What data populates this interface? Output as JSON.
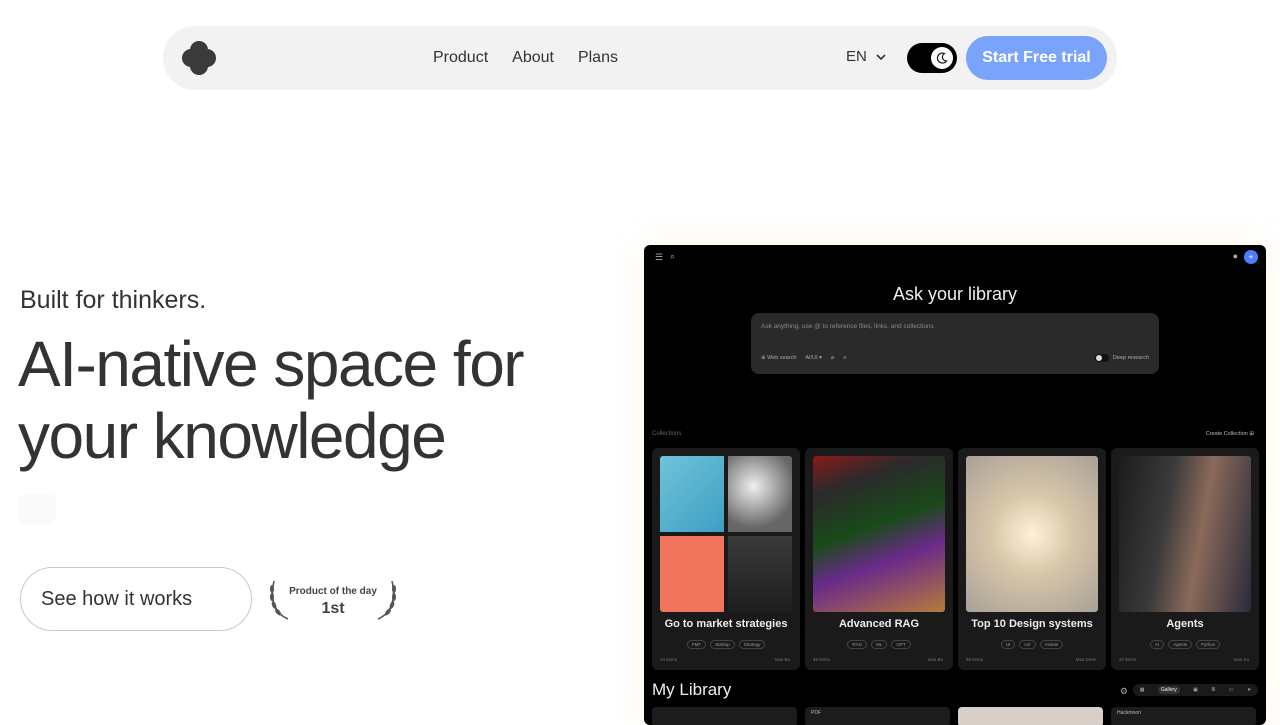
{
  "nav": {
    "links": [
      "Product",
      "About",
      "Plans"
    ],
    "language": "EN",
    "theme_mode": "dark",
    "cta_label": "Start Free trial"
  },
  "hero": {
    "kicker": "Built for thinkers.",
    "headline": "AI-native space for your knowledge",
    "secondary_button": "See how it works",
    "award_line1": "Product of the day",
    "award_line2": "1st"
  },
  "app": {
    "ask_title": "Ask your library",
    "ask_placeholder": "Ask anything, use @ to reference files, links, and collections",
    "tools": {
      "web_search": "Web search",
      "model": "AI/UI",
      "deep_research": "Deep research"
    },
    "collections_label": "Collections",
    "create_collection": "Create Collection",
    "cards": [
      {
        "title": "Go to market strategies",
        "tags": [
          "PMF",
          "Startup",
          "Strategy"
        ],
        "count": "14 items",
        "owner": "Ivan Bo"
      },
      {
        "title": "Advanced RAG",
        "tags": [
          "RAG",
          "ML",
          "GPT"
        ],
        "count": "45 items",
        "owner": "Ivan Bo"
      },
      {
        "title": "Top 10 Design systems",
        "tags": [
          "UI",
          "UX",
          "Assets"
        ],
        "count": "96 items",
        "owner": "Max Drive"
      },
      {
        "title": "Agents",
        "tags": [
          "AI",
          "Agents",
          "Python"
        ],
        "count": "27 items",
        "owner": "Ivan Ko"
      }
    ],
    "my_library": "My Library",
    "view_mode": "Gallery",
    "library_items": [
      "",
      "PDF",
      "",
      "Hackmoon"
    ]
  },
  "colors": {
    "accent": "#7aa3fb",
    "app_bg": "#000000",
    "nav_bg": "#f2f2f2",
    "text": "#333333"
  }
}
